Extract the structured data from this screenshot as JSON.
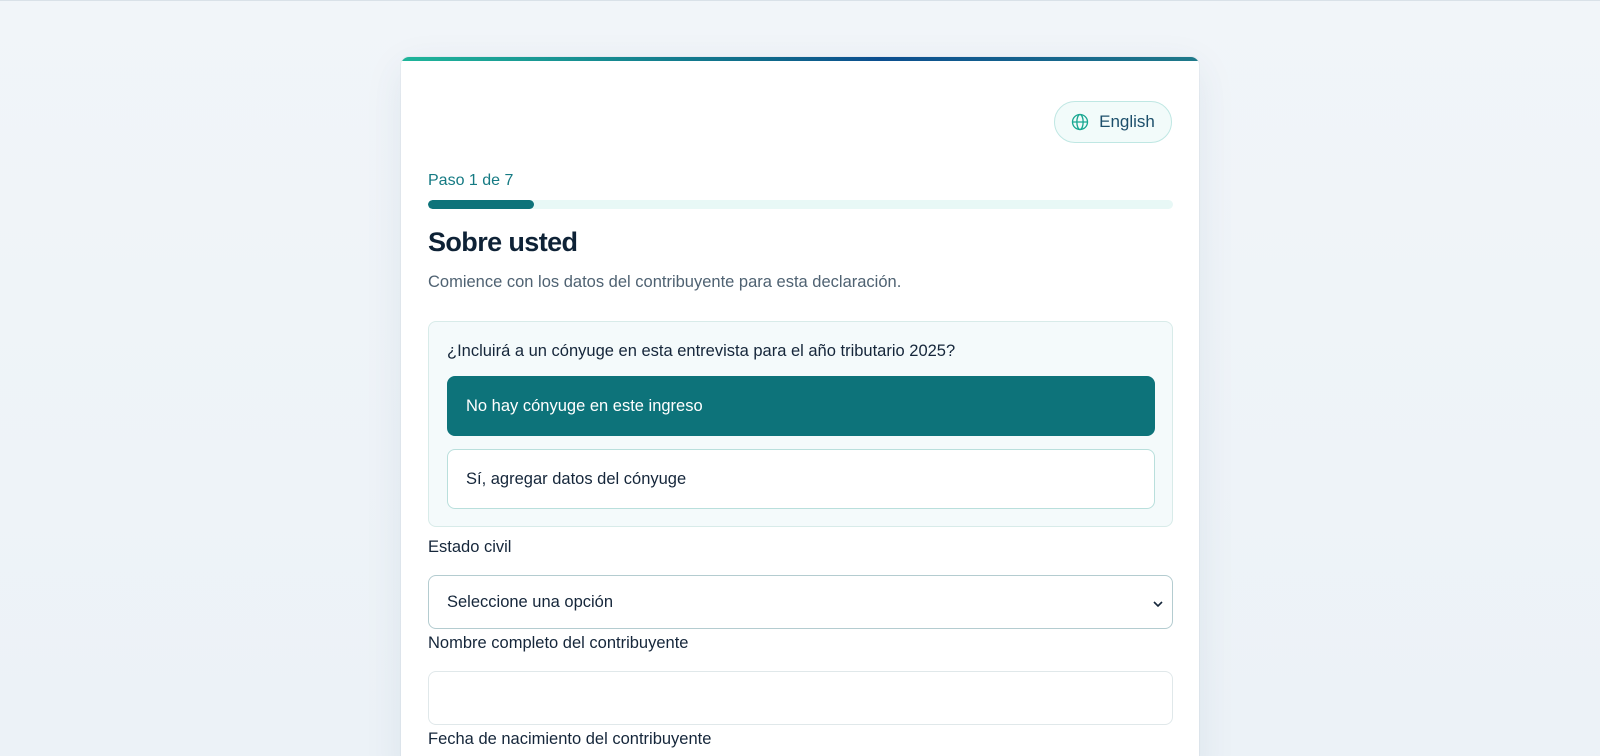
{
  "language_toggle": {
    "label": "English",
    "icon": "globe-icon"
  },
  "progress": {
    "step_label": "Paso 1 de 7",
    "current": 1,
    "total": 7
  },
  "section": {
    "title": "Sobre usted",
    "subtitle": "Comience con los datos del contribuyente para esta declaración."
  },
  "spouse": {
    "question": "¿Incluirá a un cónyuge en esta entrevista para el año tributario 2025?",
    "options": [
      {
        "label": "No hay cónyuge en este ingreso",
        "selected": true
      },
      {
        "label": "Sí, agregar datos del cónyuge",
        "selected": false
      }
    ]
  },
  "fields": {
    "marital_status": {
      "label": "Estado civil",
      "value": "Seleccione una opción"
    },
    "full_name": {
      "label": "Nombre completo del contribuyente",
      "value": ""
    },
    "birth_date": {
      "label": "Fecha de nacimiento del contribuyente"
    }
  },
  "colors": {
    "accent": "#0d737a",
    "accent_light": "#e8f8f6",
    "heading": "#0e2236"
  }
}
